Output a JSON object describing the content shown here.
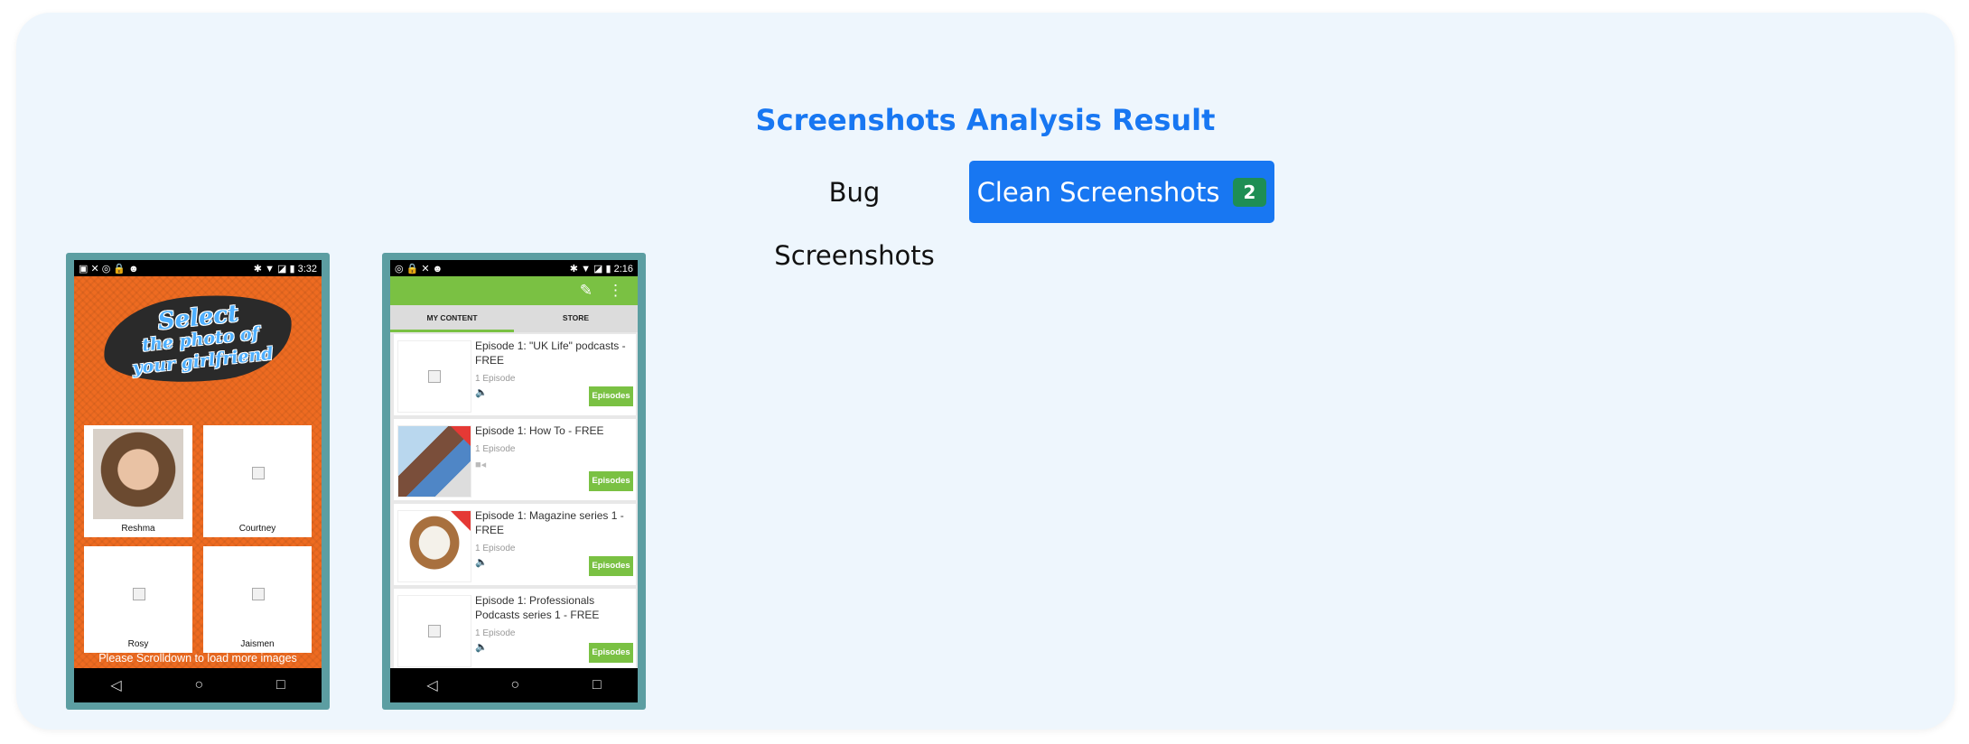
{
  "page": {
    "title": "Screenshots Analysis Result"
  },
  "tabs": {
    "bug_label": "Bug Screenshots",
    "clean_label": "Clean Screenshots",
    "clean_count": "2"
  },
  "colors": {
    "accent": "#1877f2",
    "badge": "#1e8e54",
    "card_bg": "#eef6fd",
    "frame": "#5c9ea2",
    "app_green": "#7ac143",
    "app_orange": "#ee6b21"
  },
  "screenshot1": {
    "status_time": "3:32",
    "heading_line1": "Select",
    "heading_line2": "the photo of",
    "heading_line3": "your girlfriend",
    "tiles": [
      "Reshma",
      "Courtney",
      "Rosy",
      "Jaismen"
    ],
    "hint": "Please Scrolldown to load more images"
  },
  "screenshot2": {
    "status_time": "2:16",
    "tab_my_content": "MY CONTENT",
    "tab_store": "STORE",
    "rows": [
      {
        "title": "Episode 1: \"UK Life\" podcasts - FREE",
        "meta": "1 Episode",
        "button": "Episodes"
      },
      {
        "title": "Episode 1: How To - FREE",
        "meta": "1 Episode",
        "button": "Episodes"
      },
      {
        "title": "Episode 1: Magazine series 1 - FREE",
        "meta": "1 Episode",
        "button": "Episodes"
      },
      {
        "title": "Episode 1: Professionals Podcasts series 1 - FREE",
        "meta": "1 Episode",
        "button": "Episodes"
      }
    ]
  }
}
